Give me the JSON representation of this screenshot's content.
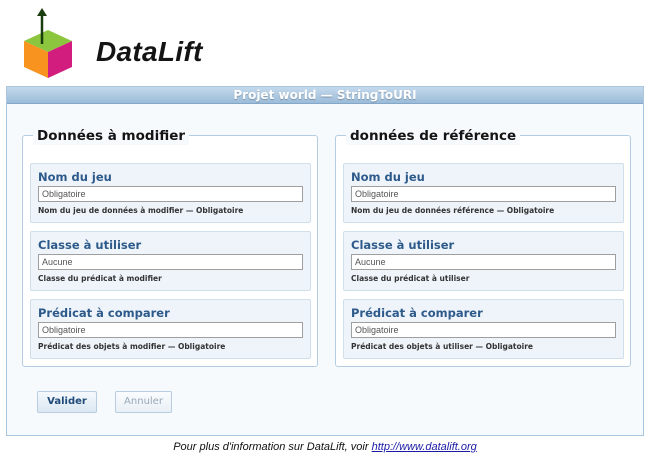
{
  "header": {
    "logo_text": "DataLift"
  },
  "panel": {
    "title": "Projet world — StringToURI"
  },
  "source_group": {
    "legend": "Données à modifier",
    "fields": [
      {
        "label": "Nom du jeu",
        "value": "Obligatoire",
        "help": "Nom du jeu de données à modifier — Obligatoire"
      },
      {
        "label": "Classe à utiliser",
        "value": "Aucune",
        "help": "Classe du prédicat à modifier"
      },
      {
        "label": "Prédicat à comparer",
        "value": "Obligatoire",
        "help": "Prédicat des objets à modifier — Obligatoire"
      }
    ]
  },
  "reference_group": {
    "legend": "données de référence",
    "fields": [
      {
        "label": "Nom du jeu",
        "value": "Obligatoire",
        "help": "Nom du jeu de données référence — Obligatoire"
      },
      {
        "label": "Classe à utiliser",
        "value": "Aucune",
        "help": "Classe du prédicat à utiliser"
      },
      {
        "label": "Prédicat à comparer",
        "value": "Obligatoire",
        "help": "Prédicat des objets à utiliser — Obligatoire"
      }
    ]
  },
  "actions": {
    "submit_label": "Valider",
    "cancel_label": "Annuler"
  },
  "footer": {
    "text": "Pour plus d'information sur DataLift, voir",
    "link_text": "http://www.datalift.org"
  }
}
